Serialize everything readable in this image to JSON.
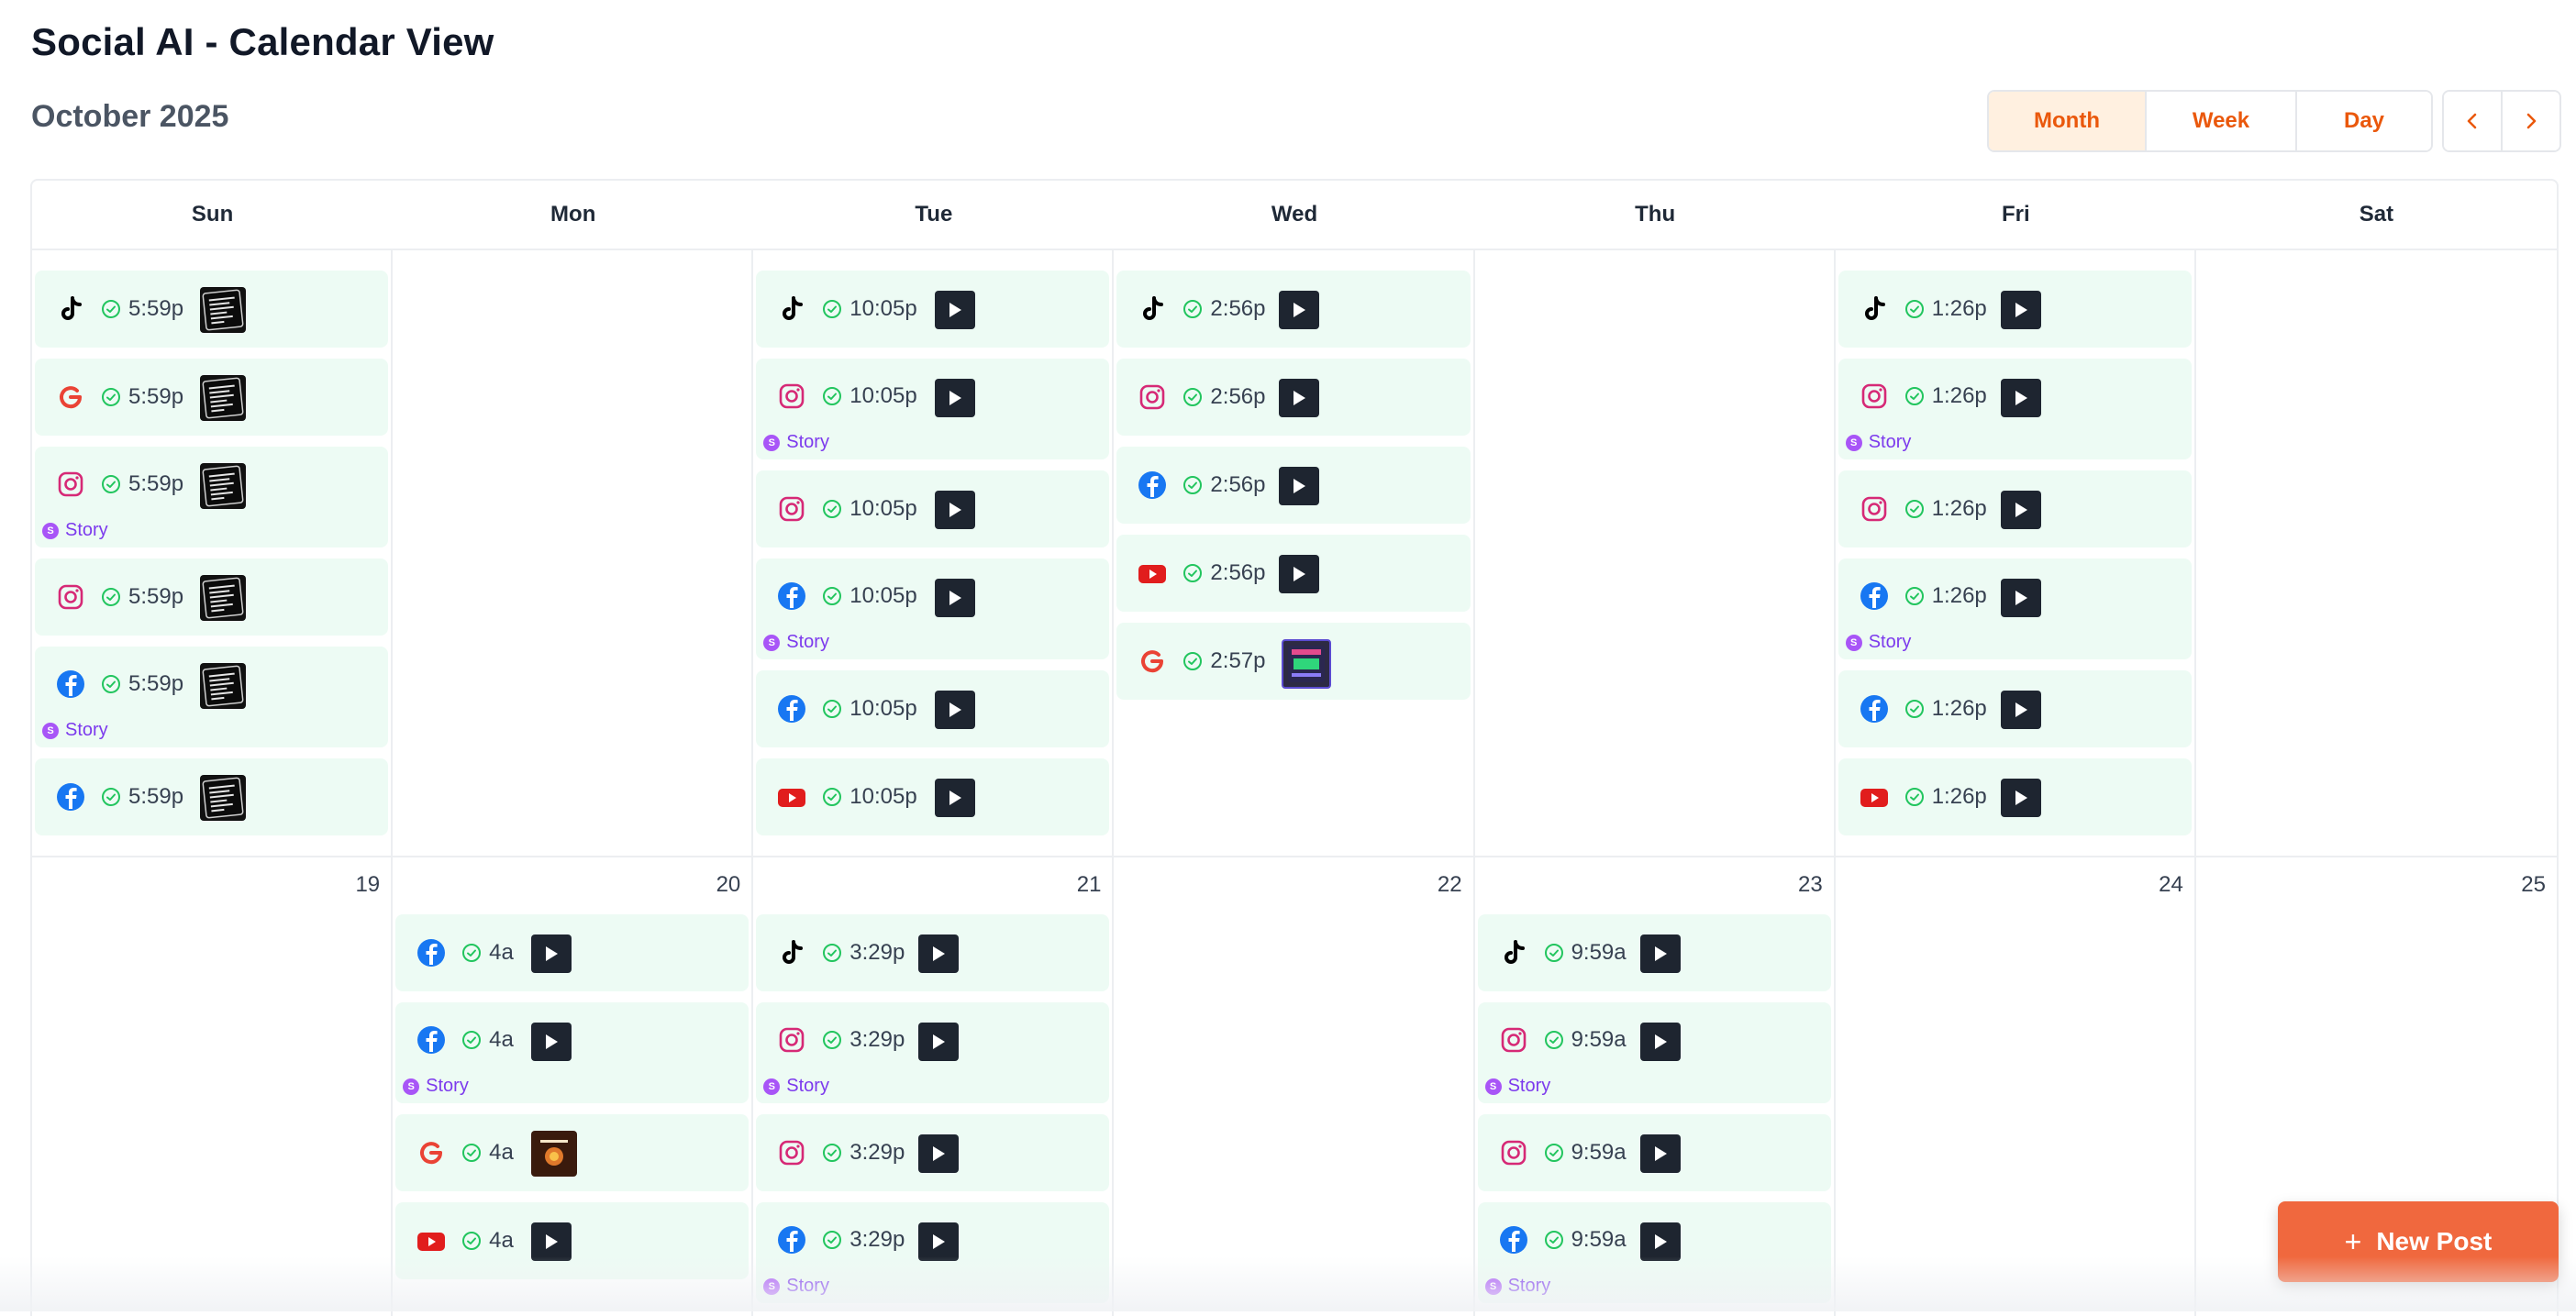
{
  "app": {
    "title": "Social AI - Calendar View"
  },
  "toolbar": {
    "month_label": "October 2025",
    "views": [
      "Month",
      "Week",
      "Day"
    ],
    "active_view": "Month"
  },
  "weekdays": [
    "Sun",
    "Mon",
    "Tue",
    "Wed",
    "Thu",
    "Fri",
    "Sat"
  ],
  "story_label": "Story",
  "story_dot": "S",
  "weeks": [
    {
      "days": [
        {
          "num": "",
          "posts": [
            {
              "platform": "tiktok-icon",
              "time": "5:59p",
              "thumb": "image",
              "story": false
            },
            {
              "platform": "google-icon",
              "time": "5:59p",
              "thumb": "image",
              "story": false
            },
            {
              "platform": "instagram-icon",
              "time": "5:59p",
              "thumb": "image",
              "story": true
            },
            {
              "platform": "instagram-icon",
              "time": "5:59p",
              "thumb": "image",
              "story": false
            },
            {
              "platform": "facebook-icon",
              "time": "5:59p",
              "thumb": "image",
              "story": true
            },
            {
              "platform": "facebook-icon",
              "time": "5:59p",
              "thumb": "image",
              "story": false
            }
          ]
        },
        {
          "num": "",
          "posts": []
        },
        {
          "num": "",
          "posts": [
            {
              "platform": "tiktok-icon",
              "time": "10:05p",
              "thumb": "video",
              "story": false
            },
            {
              "platform": "instagram-icon",
              "time": "10:05p",
              "thumb": "video",
              "story": true
            },
            {
              "platform": "instagram-icon",
              "time": "10:05p",
              "thumb": "video",
              "story": false
            },
            {
              "platform": "facebook-icon",
              "time": "10:05p",
              "thumb": "video",
              "story": true
            },
            {
              "platform": "facebook-icon",
              "time": "10:05p",
              "thumb": "video",
              "story": false
            },
            {
              "platform": "youtube-icon",
              "time": "10:05p",
              "thumb": "video",
              "story": false
            }
          ]
        },
        {
          "num": "",
          "posts": [
            {
              "platform": "tiktok-icon",
              "time": "2:56p",
              "thumb": "video",
              "story": false
            },
            {
              "platform": "instagram-icon",
              "time": "2:56p",
              "thumb": "video",
              "story": false
            },
            {
              "platform": "facebook-icon",
              "time": "2:56p",
              "thumb": "video",
              "story": false
            },
            {
              "platform": "youtube-icon",
              "time": "2:56p",
              "thumb": "video",
              "story": false
            },
            {
              "platform": "google-icon",
              "time": "2:57p",
              "thumb": "image2",
              "story": false
            }
          ]
        },
        {
          "num": "",
          "posts": []
        },
        {
          "num": "",
          "posts": [
            {
              "platform": "tiktok-icon",
              "time": "1:26p",
              "thumb": "video",
              "story": false
            },
            {
              "platform": "instagram-icon",
              "time": "1:26p",
              "thumb": "video",
              "story": true
            },
            {
              "platform": "instagram-icon",
              "time": "1:26p",
              "thumb": "video",
              "story": false
            },
            {
              "platform": "facebook-icon",
              "time": "1:26p",
              "thumb": "video",
              "story": true
            },
            {
              "platform": "facebook-icon",
              "time": "1:26p",
              "thumb": "video",
              "story": false
            },
            {
              "platform": "youtube-icon",
              "time": "1:26p",
              "thumb": "video",
              "story": false
            }
          ]
        },
        {
          "num": "",
          "posts": []
        }
      ]
    },
    {
      "days": [
        {
          "num": "19",
          "posts": []
        },
        {
          "num": "20",
          "posts": [
            {
              "platform": "facebook-icon",
              "time": "4a",
              "thumb": "video",
              "story": false
            },
            {
              "platform": "facebook-icon",
              "time": "4a",
              "thumb": "video",
              "story": true
            },
            {
              "platform": "google-icon",
              "time": "4a",
              "thumb": "image3",
              "story": false
            },
            {
              "platform": "youtube-icon",
              "time": "4a",
              "thumb": "video",
              "story": false
            }
          ]
        },
        {
          "num": "21",
          "posts": [
            {
              "platform": "tiktok-icon",
              "time": "3:29p",
              "thumb": "video",
              "story": false
            },
            {
              "platform": "instagram-icon",
              "time": "3:29p",
              "thumb": "video",
              "story": true
            },
            {
              "platform": "instagram-icon",
              "time": "3:29p",
              "thumb": "video",
              "story": false
            },
            {
              "platform": "facebook-icon",
              "time": "3:29p",
              "thumb": "video",
              "story": true
            }
          ]
        },
        {
          "num": "22",
          "posts": []
        },
        {
          "num": "23",
          "posts": [
            {
              "platform": "tiktok-icon",
              "time": "9:59a",
              "thumb": "video",
              "story": false
            },
            {
              "platform": "instagram-icon",
              "time": "9:59a",
              "thumb": "video",
              "story": true
            },
            {
              "platform": "instagram-icon",
              "time": "9:59a",
              "thumb": "video",
              "story": false
            },
            {
              "platform": "facebook-icon",
              "time": "9:59a",
              "thumb": "video",
              "story": true
            }
          ]
        },
        {
          "num": "24",
          "posts": []
        },
        {
          "num": "25",
          "posts": []
        }
      ]
    }
  ],
  "fab": {
    "label": "New Post",
    "plus": "+"
  },
  "colors": {
    "accent": "#f0683e",
    "active_view_bg": "#fff0e0",
    "post_bg": "#edfbf4",
    "status_ok": "#22c55e",
    "story": "#a855f7"
  }
}
